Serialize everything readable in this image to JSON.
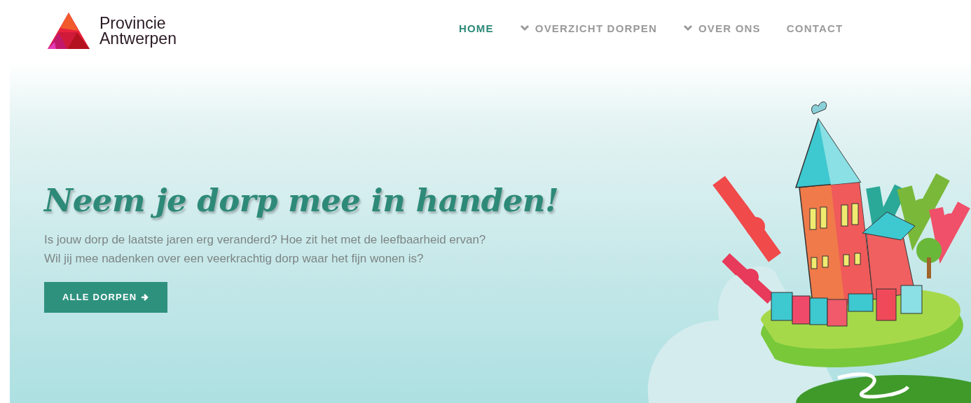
{
  "logo": {
    "line_1": "Provincie",
    "line_2": "Antwerpen"
  },
  "nav": [
    {
      "label": "HOME",
      "kind": "link",
      "selected": true
    },
    {
      "label": "OVERZICHT DORPEN",
      "kind": "dropdown",
      "selected": false
    },
    {
      "label": "OVER ONS",
      "kind": "dropdown",
      "selected": false
    },
    {
      "label": "CONTACT",
      "kind": "link",
      "selected": false
    }
  ],
  "hero": {
    "heading": "Neem je dorp mee in handen!",
    "intro_lines": [
      "Is jouw dorp de laatste jaren erg veranderd? Hoe zit het met de leefbaarheid ervan?",
      "Wil jij mee nadenken over een veerkrachtig dorp waar het fijn wonen is?"
    ],
    "button": "ALLE DORPEN"
  }
}
